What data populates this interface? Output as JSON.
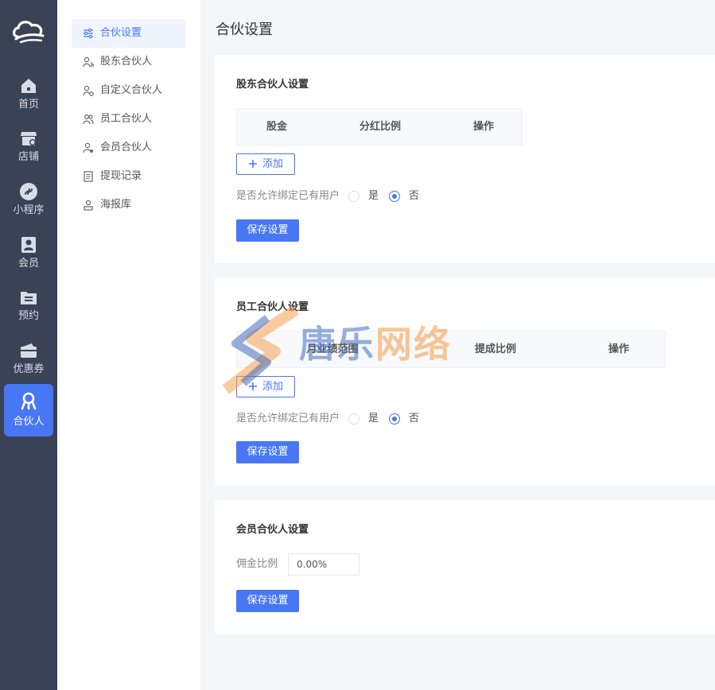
{
  "rail": {
    "items": [
      {
        "label": "首页",
        "icon": "home-icon"
      },
      {
        "label": "店铺",
        "icon": "store-icon"
      },
      {
        "label": "小程序",
        "icon": "miniprogram-icon"
      },
      {
        "label": "会员",
        "icon": "member-icon"
      },
      {
        "label": "预约",
        "icon": "booking-icon"
      },
      {
        "label": "优惠券",
        "icon": "coupon-icon"
      },
      {
        "label": "合伙人",
        "icon": "partner-icon"
      }
    ],
    "active_index": 6
  },
  "subnav": {
    "items": [
      {
        "label": "合伙设置",
        "icon": "sliders-icon"
      },
      {
        "label": "股东合伙人",
        "icon": "shareholder-icon"
      },
      {
        "label": "自定义合伙人",
        "icon": "custom-partner-icon"
      },
      {
        "label": "员工合伙人",
        "icon": "staff-icon"
      },
      {
        "label": "会员合伙人",
        "icon": "member-partner-icon"
      },
      {
        "label": "提现记录",
        "icon": "document-icon"
      },
      {
        "label": "海报库",
        "icon": "poster-icon"
      }
    ],
    "active_index": 0
  },
  "page": {
    "title": "合伙设置"
  },
  "shareholder": {
    "title": "股东合伙人设置",
    "columns": [
      "股金",
      "分红比例",
      "操作"
    ],
    "add_label": "添加",
    "bind_label": "是否允许绑定已有用户",
    "yes": "是",
    "no": "否",
    "selected": "否",
    "save_label": "保存设置"
  },
  "staff": {
    "title": "员工合伙人设置",
    "columns": [
      "月业绩范围",
      "提成比例",
      "操作"
    ],
    "add_label": "添加",
    "bind_label": "是否允许绑定已有用户",
    "yes": "是",
    "no": "否",
    "selected": "否",
    "save_label": "保存设置"
  },
  "member": {
    "title": "会员合伙人设置",
    "commission_label": "佣金比例",
    "commission_value": "0.00%",
    "save_label": "保存设置"
  },
  "watermark": {
    "text_a": "唐乐",
    "text_b": "网络"
  },
  "colors": {
    "accent": "#4877f6",
    "rail_bg": "#3a4256",
    "page_bg": "#f5f6f8"
  }
}
